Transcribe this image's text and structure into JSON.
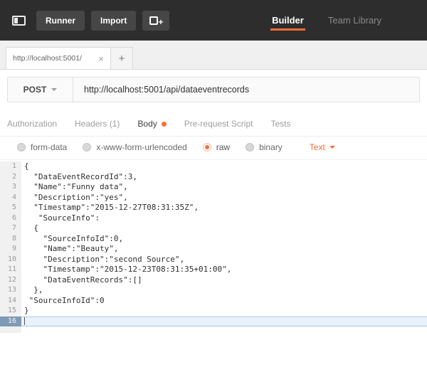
{
  "colors": {
    "accent": "#ff6c37",
    "topbar_bg": "#2d2d2d",
    "active_line_bg": "#e9f2fb",
    "active_gutter_bg": "#7e9ab6"
  },
  "topbar": {
    "runner_label": "Runner",
    "import_label": "Import",
    "nav": [
      {
        "label": "Builder",
        "active": true
      },
      {
        "label": "Team Library",
        "active": false
      }
    ]
  },
  "tabstrip": {
    "active_tab_title": "http://localhost:5001/",
    "close_label": "×",
    "new_tab_label": "+"
  },
  "request": {
    "method": "POST",
    "url": "http://localhost:5001/api/dataeventrecords"
  },
  "request_tabs": [
    {
      "label": "Authorization",
      "active": false,
      "dot": false
    },
    {
      "label": "Headers (1)",
      "active": false,
      "dot": false
    },
    {
      "label": "Body",
      "active": true,
      "dot": true
    },
    {
      "label": "Pre-request Script",
      "active": false,
      "dot": false
    },
    {
      "label": "Tests",
      "active": false,
      "dot": false
    }
  ],
  "body_modes": [
    {
      "label": "form-data",
      "selected": false
    },
    {
      "label": "x-www-form-urlencoded",
      "selected": false
    },
    {
      "label": "raw",
      "selected": true
    },
    {
      "label": "binary",
      "selected": false
    }
  ],
  "body_format": {
    "label": "Text"
  },
  "editor": {
    "active_line": 16,
    "lines": [
      "{",
      "  \"DataEventRecordId\":3,",
      "  \"Name\":\"Funny data\",",
      "  \"Description\":\"yes\",",
      "  \"Timestamp\":\"2015-12-27T08:31:35Z\",",
      "   \"SourceInfo\":",
      "  {",
      "    \"SourceInfoId\":0,",
      "    \"Name\":\"Beauty\",",
      "    \"Description\":\"second Source\",",
      "    \"Timestamp\":\"2015-12-23T08:31:35+01:00\",",
      "    \"DataEventRecords\":[]",
      "  },",
      " \"SourceInfoId\":0",
      "}",
      ""
    ]
  }
}
